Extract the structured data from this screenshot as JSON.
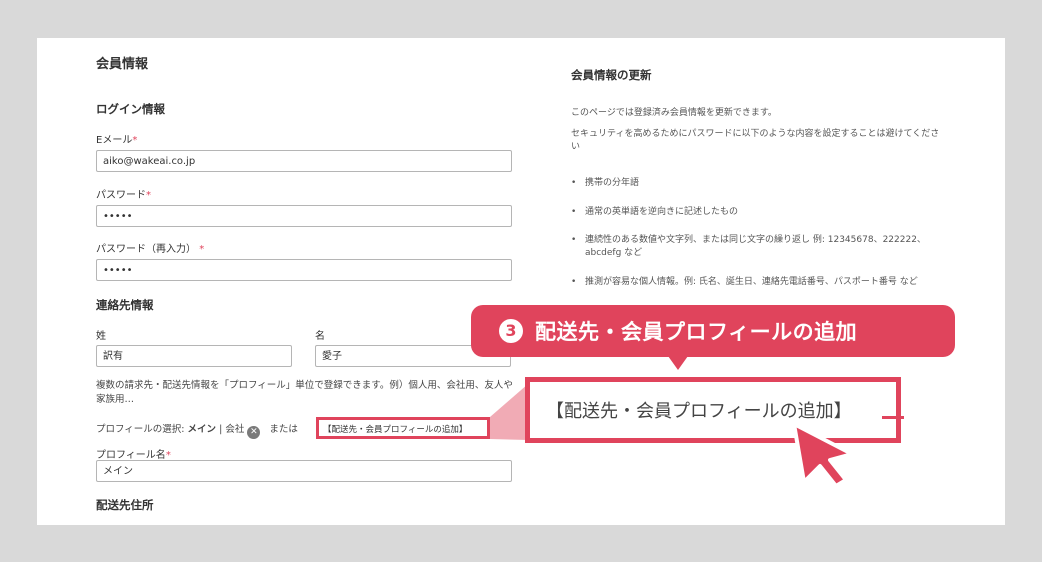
{
  "left": {
    "section_title": "会員情報",
    "login": {
      "title": "ログイン情報",
      "email_label": "Eメール",
      "email_value": "aiko@wakeai.co.jp",
      "password_label": "パスワード",
      "password_value": "•••••",
      "password2_label": "パスワード（再入力）",
      "password2_value": "•••••",
      "required_mark": "*"
    },
    "contact": {
      "title": "連絡先情報",
      "last_name_label": "姓",
      "last_name_value": "訳有",
      "first_name_label": "名",
      "first_name_value": "愛子",
      "profile_note": "複数の請求先・配送先情報を「プロフィール」単位で登録できます。例）個人用、会社用、友人や家族用…",
      "profile_select_prefix": "プロフィールの選択:",
      "profile_selected": "メイン",
      "profile_sep": "|",
      "profile_other": "会社",
      "profile_or": "または",
      "add_profile_link": "【配送先・会員プロフィールの追加】",
      "profile_name_label": "プロフィール名",
      "profile_name_value": "メイン"
    },
    "shipping_title": "配送先住所"
  },
  "right": {
    "title": "会員情報の更新",
    "intro": "このページでは登録済み会員情報を更新できます。",
    "security": "セキュリティを高めるためにパスワードに以下のような内容を設定することは避けてください",
    "bullets": [
      "携帯の分年語",
      "通常の英単語を逆向きに記述したもの",
      "連続性のある数値や文字列、または同じ文字の繰り返し 例: 12345678、222222、abcdefg など",
      "推測が容易な個人情報。例: 氏名、誕生日、連絡先電話番号、パスポート番号 など"
    ]
  },
  "callout": {
    "number": "3",
    "text": "配送先・会員プロフィールの追加",
    "zoom_text": "【配送先・会員プロフィールの追加】"
  },
  "colors": {
    "accent": "#e0445c",
    "background": "#d9d9d9"
  }
}
